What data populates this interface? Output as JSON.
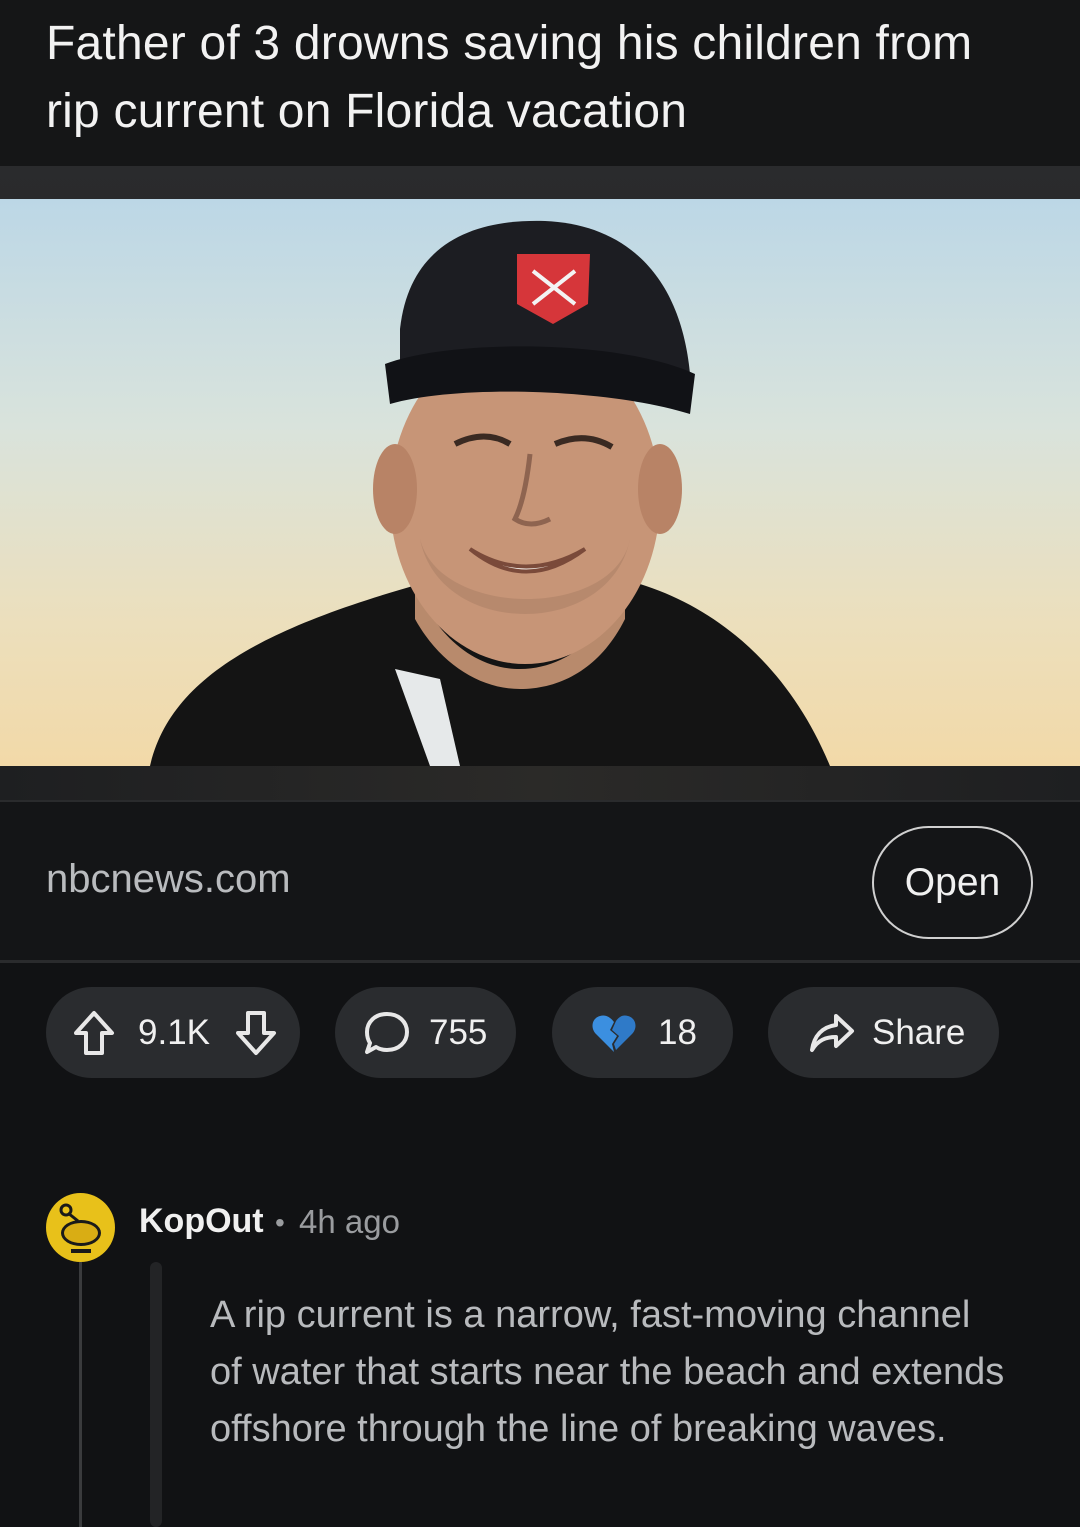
{
  "post": {
    "title": "Father of 3 drowns saving his children from rip current on Florida vacation",
    "link_domain": "nbcnews.com",
    "open_label": "Open",
    "vote_count": "9.1K",
    "comment_count": "755",
    "award_count": "18",
    "share_label": "Share"
  },
  "comment": {
    "username": "KopOut",
    "separator": "•",
    "time_ago": "4h ago",
    "body": "A rip current is a narrow, fast-moving channel of water that starts near the beach and extends offshore through the line of breaking waves."
  },
  "icons": {
    "upvote": "upvote-icon",
    "downvote": "downvote-icon",
    "comment": "comment-bubble-icon",
    "award": "broken-heart-icon",
    "share": "share-arrow-icon",
    "avatar": "snoo-avatar-icon"
  },
  "colors": {
    "background": "#111214",
    "pill": "#2a2c2f",
    "avatar": "#e8c11a",
    "award_blue": "#3b8fe0"
  }
}
